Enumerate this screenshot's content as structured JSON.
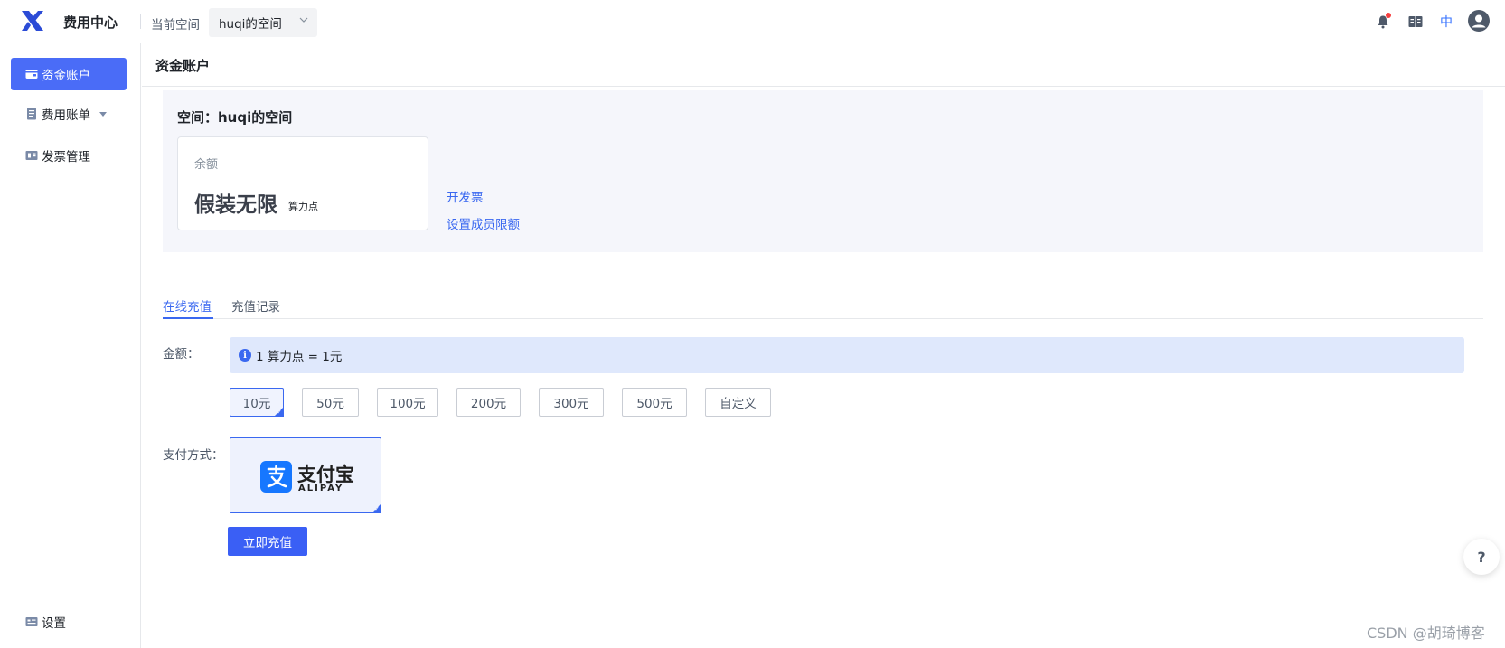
{
  "header": {
    "app_title": "费用中心",
    "space_label": "当前空间",
    "space_value": "huqi的空间",
    "lang": "中"
  },
  "sidebar": {
    "items": [
      {
        "label": "资金账户",
        "icon": "wallet-icon"
      },
      {
        "label": "费用账单",
        "icon": "bill-icon"
      },
      {
        "label": "发票管理",
        "icon": "invoice-icon"
      }
    ],
    "settings_label": "设置"
  },
  "main": {
    "title": "资金账户",
    "panel": {
      "title": "空间：huqi的空间",
      "balance_label": "余额",
      "balance_value": "假装无限",
      "balance_unit": "算力点",
      "link_invoice": "开发票",
      "link_member_limit": "设置成员限额"
    },
    "tabs": [
      {
        "label": "在线充值"
      },
      {
        "label": "充值记录"
      }
    ],
    "amount_label": "金额：",
    "info_text": "1 算力点 = 1元",
    "amounts": [
      "10元",
      "50元",
      "100元",
      "200元",
      "300元",
      "500元",
      "自定义"
    ],
    "payment_label": "支付方式：",
    "alipay_name": "支付宝",
    "alipay_sub": "ALIPAY",
    "submit_label": "立即充值"
  },
  "help_label": "?",
  "watermark": "CSDN @胡琦博客",
  "colors": {
    "accent": "#3a68f0",
    "active_nav": "#4a6cf7",
    "alipay": "#1677ff"
  }
}
